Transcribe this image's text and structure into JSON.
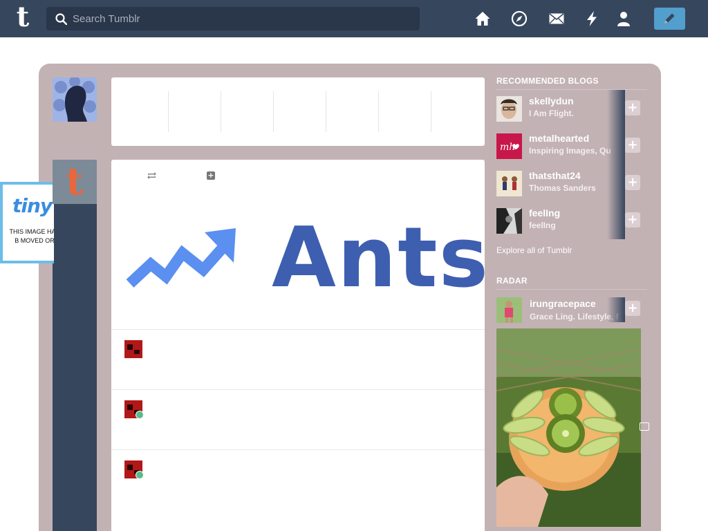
{
  "header": {
    "logo_letter": "t",
    "search_placeholder": "Search Tumblr",
    "nav_icons": [
      "home-icon",
      "explore-icon",
      "inbox-icon",
      "activity-icon",
      "account-icon"
    ],
    "compose_icon": "pencil-icon",
    "colors": {
      "bar": "#36465d",
      "compose": "#529ecc"
    }
  },
  "left": {
    "tiny_logo": "tiny",
    "tiny_message": "THIS IMAGE HAS B MOVED OR"
  },
  "post": {
    "image_text": "Ants",
    "icons": [
      "reblog-icon",
      "plus-icon"
    ]
  },
  "recommended": {
    "heading": "RECOMMENDED BLOGS",
    "blogs": [
      {
        "name": "skellydun",
        "title": "I Am Flight."
      },
      {
        "name": "metalhearted",
        "title": "Inspiring Images, Qu"
      },
      {
        "name": "thatsthat24",
        "title": "Thomas Sanders"
      },
      {
        "name": "feelIng",
        "title": "feelIng"
      }
    ],
    "explore_link": "Explore all of Tumblr"
  },
  "radar": {
    "heading": "RADAR",
    "blog": {
      "name": "irungracepace",
      "title": "Grace Ling. Lifestyle, f"
    }
  },
  "colors": {
    "dashboard_bg": "#c3b2b4",
    "accent_green": "#56bc8a"
  }
}
